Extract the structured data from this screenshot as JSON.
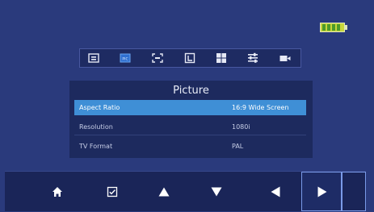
{
  "status": {
    "battery_icon": "battery-full-icon",
    "battery_color": "#c7d63a"
  },
  "iconbar": {
    "items": [
      {
        "icon": "display-icon"
      },
      {
        "icon": "picture-icon",
        "selected": true
      },
      {
        "icon": "fit-screen-icon"
      },
      {
        "icon": "crop-icon"
      },
      {
        "icon": "grid-icon"
      },
      {
        "icon": "sliders-icon"
      },
      {
        "icon": "camera-icon"
      }
    ]
  },
  "panel": {
    "title": "Picture",
    "rows": [
      {
        "label": "Aspect Ratio",
        "value": "16:9 Wide Screen",
        "selected": true
      },
      {
        "label": "Resolution",
        "value": "1080i"
      },
      {
        "label": "TV Format",
        "value": "PAL"
      }
    ]
  },
  "bottombar": {
    "buttons": [
      {
        "icon": "home-icon"
      },
      {
        "icon": "checkbox-icon"
      },
      {
        "icon": "arrow-up-icon"
      },
      {
        "icon": "arrow-down-icon"
      },
      {
        "icon": "arrow-left-icon"
      },
      {
        "icon": "arrow-right-icon",
        "active": true
      }
    ]
  },
  "colors": {
    "background": "#2a3a7c",
    "highlight": "#3f8fd6",
    "panel": "#1d2a5e"
  }
}
